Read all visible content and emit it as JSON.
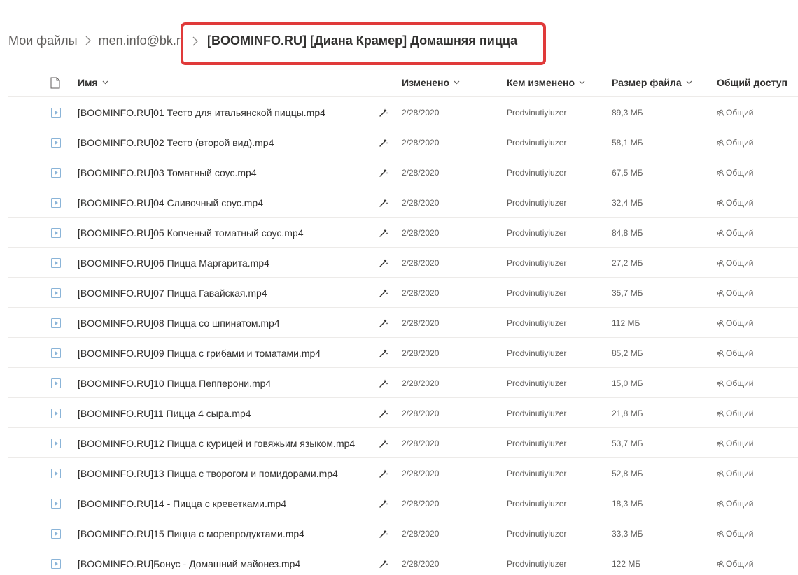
{
  "breadcrumb": {
    "items": [
      "Мои файлы",
      "men.info@bk.ru"
    ],
    "current": "[BOOMINFO.RU] [Диана Крамер] Домашняя пицца"
  },
  "highlight_color": "#e03a3a",
  "columns": {
    "name": "Имя",
    "modified": "Изменено",
    "modified_by": "Кем изменено",
    "size": "Размер файла",
    "sharing": "Общий доступ"
  },
  "files": [
    {
      "name": "[BOOMINFO.RU]01 Тесто для итальянской пиццы.mp4",
      "modified": "2/28/2020",
      "modified_by": "Prodvinutiyiuzer",
      "size": "89,3 МБ",
      "sharing": "Общий"
    },
    {
      "name": "[BOOMINFO.RU]02 Тесто (второй вид).mp4",
      "modified": "2/28/2020",
      "modified_by": "Prodvinutiyiuzer",
      "size": "58,1 МБ",
      "sharing": "Общий"
    },
    {
      "name": "[BOOMINFO.RU]03 Томатный соус.mp4",
      "modified": "2/28/2020",
      "modified_by": "Prodvinutiyiuzer",
      "size": "67,5 МБ",
      "sharing": "Общий"
    },
    {
      "name": "[BOOMINFO.RU]04 Сливочный соус.mp4",
      "modified": "2/28/2020",
      "modified_by": "Prodvinutiyiuzer",
      "size": "32,4 МБ",
      "sharing": "Общий"
    },
    {
      "name": "[BOOMINFO.RU]05 Копченый томатный соус.mp4",
      "modified": "2/28/2020",
      "modified_by": "Prodvinutiyiuzer",
      "size": "84,8 МБ",
      "sharing": "Общий"
    },
    {
      "name": "[BOOMINFO.RU]06 Пицца Маргарита.mp4",
      "modified": "2/28/2020",
      "modified_by": "Prodvinutiyiuzer",
      "size": "27,2 МБ",
      "sharing": "Общий"
    },
    {
      "name": "[BOOMINFO.RU]07 Пицца Гавайская.mp4",
      "modified": "2/28/2020",
      "modified_by": "Prodvinutiyiuzer",
      "size": "35,7 МБ",
      "sharing": "Общий"
    },
    {
      "name": "[BOOMINFO.RU]08 Пицца со шпинатом.mp4",
      "modified": "2/28/2020",
      "modified_by": "Prodvinutiyiuzer",
      "size": "112 МБ",
      "sharing": "Общий"
    },
    {
      "name": "[BOOMINFO.RU]09 Пицца с грибами и томатами.mp4",
      "modified": "2/28/2020",
      "modified_by": "Prodvinutiyiuzer",
      "size": "85,2 МБ",
      "sharing": "Общий"
    },
    {
      "name": "[BOOMINFO.RU]10 Пицца Пепперони.mp4",
      "modified": "2/28/2020",
      "modified_by": "Prodvinutiyiuzer",
      "size": "15,0 МБ",
      "sharing": "Общий"
    },
    {
      "name": "[BOOMINFO.RU]11 Пицца 4 сыра.mp4",
      "modified": "2/28/2020",
      "modified_by": "Prodvinutiyiuzer",
      "size": "21,8 МБ",
      "sharing": "Общий"
    },
    {
      "name": "[BOOMINFO.RU]12 Пицца с курицей и говяжьим языком.mp4",
      "modified": "2/28/2020",
      "modified_by": "Prodvinutiyiuzer",
      "size": "53,7 МБ",
      "sharing": "Общий"
    },
    {
      "name": "[BOOMINFO.RU]13 Пицца с творогом и помидорами.mp4",
      "modified": "2/28/2020",
      "modified_by": "Prodvinutiyiuzer",
      "size": "52,8 МБ",
      "sharing": "Общий"
    },
    {
      "name": "[BOOMINFO.RU]14 - Пицца с креветками.mp4",
      "modified": "2/28/2020",
      "modified_by": "Prodvinutiyiuzer",
      "size": "18,3 МБ",
      "sharing": "Общий"
    },
    {
      "name": "[BOOMINFO.RU]15 Пицца с морепродуктами.mp4",
      "modified": "2/28/2020",
      "modified_by": "Prodvinutiyiuzer",
      "size": "33,3 МБ",
      "sharing": "Общий"
    },
    {
      "name": "[BOOMINFO.RU]Бонус - Домашний майонез.mp4",
      "modified": "2/28/2020",
      "modified_by": "Prodvinutiyiuzer",
      "size": "122 МБ",
      "sharing": "Общий"
    }
  ]
}
